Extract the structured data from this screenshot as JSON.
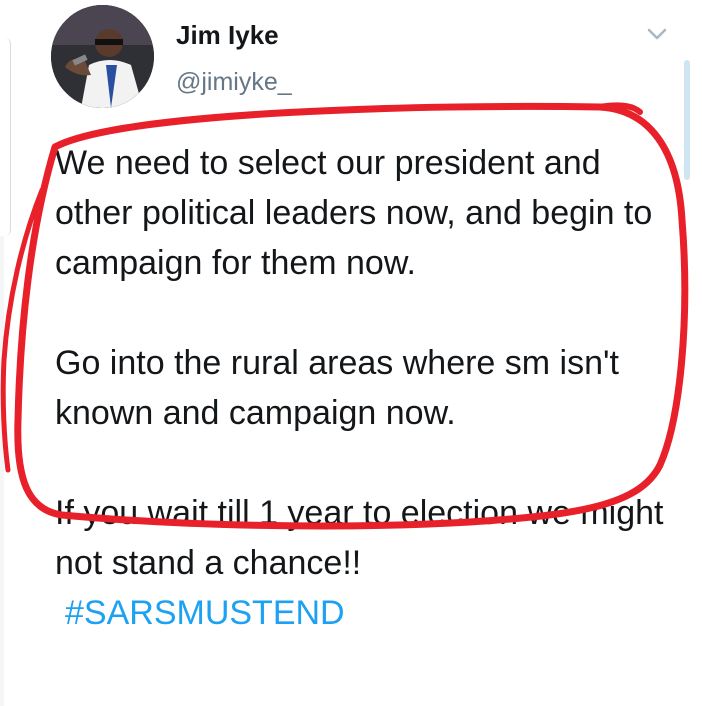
{
  "tweet": {
    "author": {
      "display_name": "Jim Iyke",
      "handle": "@jimiyke_"
    },
    "paragraphs": [
      "We need to select our president and other political leaders now, and begin to campaign for them now.",
      "Go into the rural areas where sm isn't known and campaign now.",
      "If you wait till 1 year to election we might not stand a chance!!"
    ],
    "hashtag": "#SARSMUSTEND",
    "menu_icon": "chevron-down-icon"
  },
  "colors": {
    "text": "#14171a",
    "handle": "#657786",
    "hashtag": "#1da1f2",
    "annotation": "#e8202a",
    "scrollbar": "#cfe5f2"
  }
}
